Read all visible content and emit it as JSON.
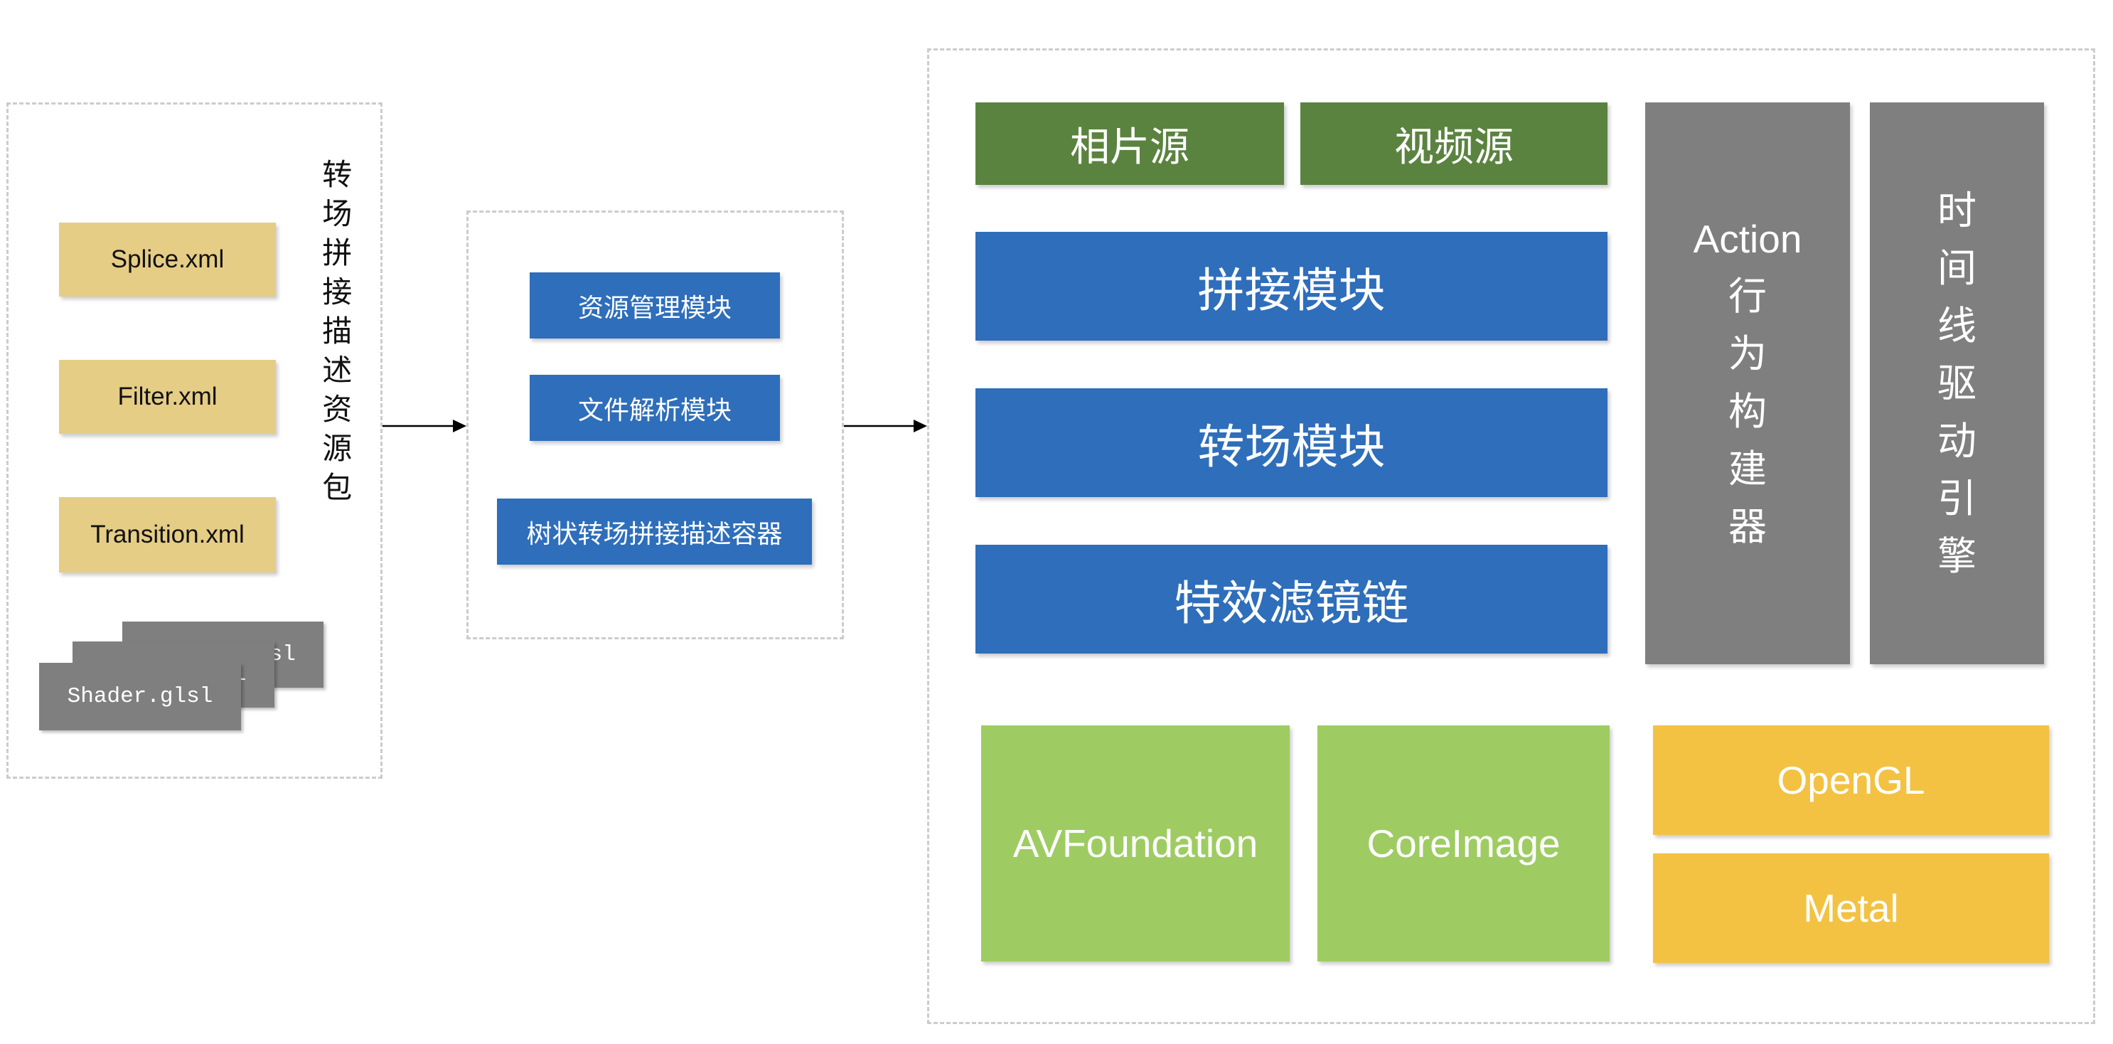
{
  "resource_package": {
    "label": "转场拼接描述资源包",
    "files": [
      "Splice.xml",
      "Filter.xml",
      "Transition.xml"
    ],
    "shader_file": "Shader.glsl"
  },
  "parser": {
    "modules": [
      "资源管理模块",
      "文件解析模块",
      "树状转场拼接描述容器"
    ]
  },
  "engine": {
    "sources": [
      "相片源",
      "视频源"
    ],
    "modules": [
      "拼接模块",
      "转场模块",
      "特效滤镜链"
    ],
    "action_builder": {
      "en": "Action",
      "cn": "行为构建器"
    },
    "timeline_engine": "时间线驱动引擎",
    "frameworks": [
      "AVFoundation",
      "CoreImage"
    ],
    "graphics_apis": [
      "OpenGL",
      "Metal"
    ]
  },
  "colors": {
    "file_tan": "#E5CD86",
    "module_blue": "#2E6EBB",
    "source_green": "#5B8340",
    "engine_gray": "#7F7F7F",
    "framework_green": "#9ECC62",
    "graphics_yellow": "#F3C243",
    "dashed_border": "#CCCCCC",
    "arrow": "#000000"
  }
}
